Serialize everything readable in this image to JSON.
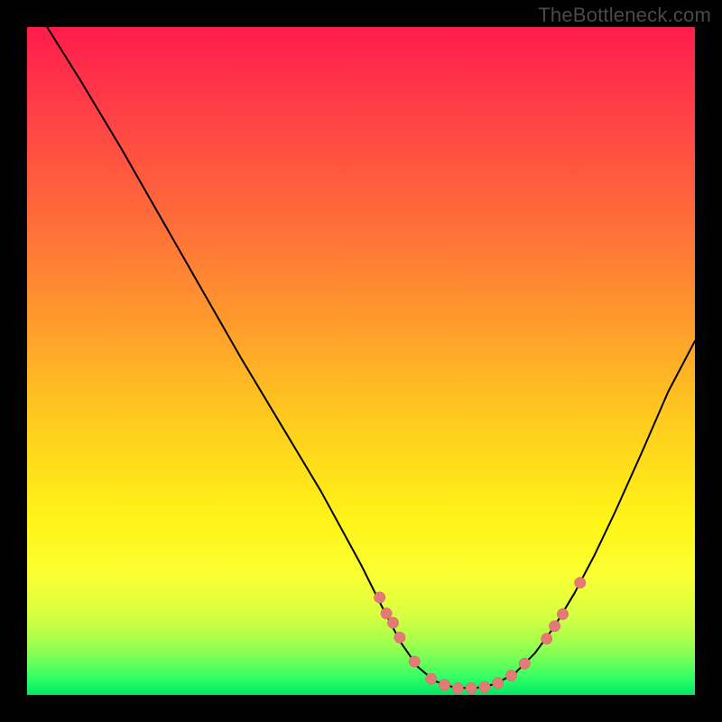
{
  "watermark": "TheBottleneck.com",
  "colors": {
    "background": "#000000",
    "curve": "#000000",
    "point_fill": "#e47a78",
    "point_stroke": "#d8605e",
    "gradient_top": "#ff1c4b",
    "gradient_bottom": "#00e864"
  },
  "chart_data": {
    "type": "line",
    "title": "",
    "xlabel": "",
    "ylabel": "",
    "xlim": [
      0,
      100
    ],
    "ylim": [
      0,
      100
    ],
    "grid": false,
    "legend": false,
    "curve_description": "Asymmetric V-shaped bottleneck curve. y≈100 represents high bottleneck (top, red); y≈0 represents no bottleneck (bottom, green). Left branch descends steeply from top-left to a flat minimum near x≈62–70, then the right branch rises more gently toward the upper-right.",
    "curve_samples": [
      {
        "x": 3.0,
        "y": 100.0
      },
      {
        "x": 8.0,
        "y": 92.0
      },
      {
        "x": 14.0,
        "y": 82.0
      },
      {
        "x": 20.0,
        "y": 71.5
      },
      {
        "x": 26.0,
        "y": 61.0
      },
      {
        "x": 32.0,
        "y": 50.5
      },
      {
        "x": 38.0,
        "y": 40.5
      },
      {
        "x": 44.0,
        "y": 30.5
      },
      {
        "x": 50.0,
        "y": 19.5
      },
      {
        "x": 53.5,
        "y": 12.5
      },
      {
        "x": 56.0,
        "y": 7.8
      },
      {
        "x": 58.5,
        "y": 4.2
      },
      {
        "x": 61.0,
        "y": 2.1
      },
      {
        "x": 64.0,
        "y": 1.1
      },
      {
        "x": 67.0,
        "y": 1.0
      },
      {
        "x": 70.0,
        "y": 1.6
      },
      {
        "x": 73.0,
        "y": 3.2
      },
      {
        "x": 76.0,
        "y": 6.2
      },
      {
        "x": 79.0,
        "y": 10.3
      },
      {
        "x": 82.0,
        "y": 15.3
      },
      {
        "x": 85.0,
        "y": 21.0
      },
      {
        "x": 88.0,
        "y": 27.3
      },
      {
        "x": 92.0,
        "y": 36.2
      },
      {
        "x": 96.0,
        "y": 45.4
      },
      {
        "x": 100.0,
        "y": 53.0
      }
    ],
    "data_points_description": "Highlighted points (salmon dots) cluster around the basin of the curve, roughly x 52–82, y 1–17.",
    "data_points": [
      {
        "x": 52.8,
        "y": 14.6
      },
      {
        "x": 53.8,
        "y": 12.2
      },
      {
        "x": 54.8,
        "y": 10.8
      },
      {
        "x": 55.8,
        "y": 8.6
      },
      {
        "x": 58.0,
        "y": 5.0
      },
      {
        "x": 60.5,
        "y": 2.4
      },
      {
        "x": 62.5,
        "y": 1.5
      },
      {
        "x": 64.5,
        "y": 1.0
      },
      {
        "x": 66.5,
        "y": 1.0
      },
      {
        "x": 68.5,
        "y": 1.2
      },
      {
        "x": 70.5,
        "y": 1.8
      },
      {
        "x": 72.5,
        "y": 2.9
      },
      {
        "x": 74.5,
        "y": 4.7
      },
      {
        "x": 77.8,
        "y": 8.4
      },
      {
        "x": 79.0,
        "y": 10.3
      },
      {
        "x": 80.2,
        "y": 12.1
      },
      {
        "x": 82.8,
        "y": 16.8
      }
    ]
  }
}
